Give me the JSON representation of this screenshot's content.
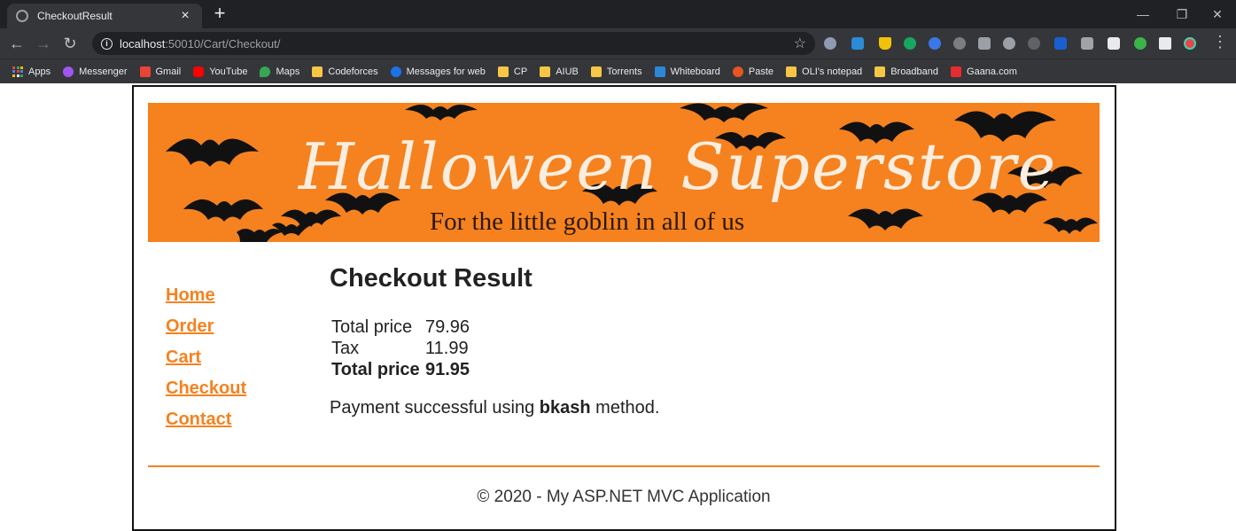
{
  "browser": {
    "tab_title": "CheckoutResult",
    "tab_close": "×",
    "new_tab": "+",
    "url_host": "localhost",
    "url_path": ":50010/Cart/Checkout/",
    "bookmarks": [
      "Apps",
      "Messenger",
      "Gmail",
      "YouTube",
      "Maps",
      "Codeforces",
      "Messages for web",
      "CP",
      "AIUB",
      "Torrents",
      "Whiteboard",
      "Paste",
      "OLI's notepad",
      "Broadband",
      "Gaana.com"
    ]
  },
  "banner": {
    "title": "Halloween Superstore",
    "subtitle": "For the little goblin in all of us"
  },
  "nav": {
    "home": "Home",
    "order": "Order",
    "cart": "Cart",
    "checkout": "Checkout",
    "contact": "Contact"
  },
  "result": {
    "heading": "Checkout Result",
    "rows": [
      {
        "label": "Total price",
        "value": "79.96"
      },
      {
        "label": "Tax",
        "value": "11.99"
      },
      {
        "label": "Total price",
        "value": "91.95"
      }
    ],
    "payment_prefix": "Payment successful using",
    "payment_method": "bkash",
    "payment_suffix": "method."
  },
  "footer": {
    "text": "© 2020 - My ASP.NET MVC Application"
  },
  "colors": {
    "accent": "#f5821f",
    "chrome_dark": "#202124",
    "chrome": "#35363a"
  }
}
